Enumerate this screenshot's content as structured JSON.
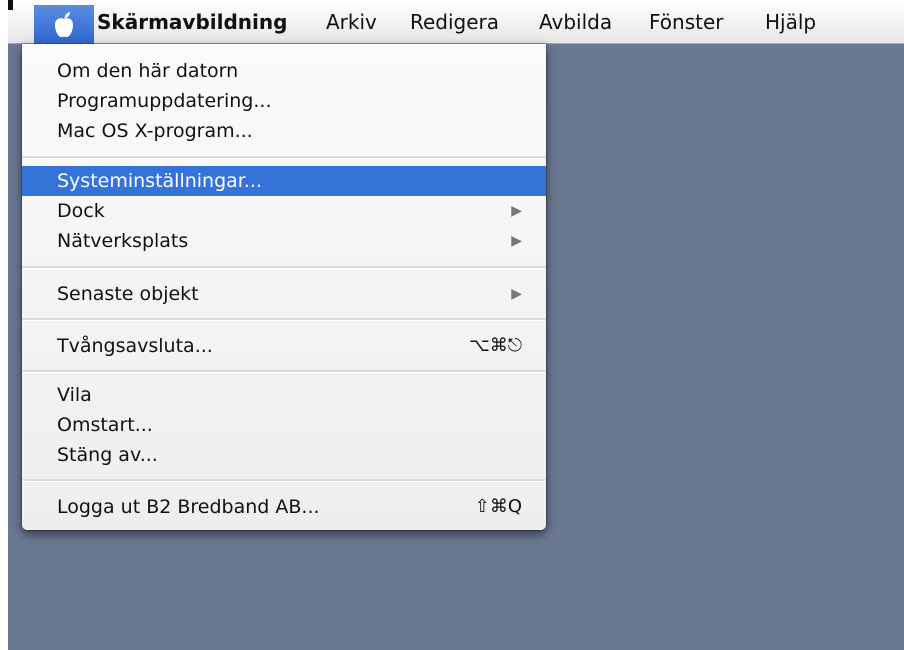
{
  "menubar": {
    "app_name": "Skärmavbildning",
    "menus": [
      "Arkiv",
      "Redigera",
      "Avbilda",
      "Fönster",
      "Hjälp"
    ]
  },
  "apple_menu": {
    "items": [
      {
        "label": "Om den här datorn"
      },
      {
        "label": "Programuppdatering..."
      },
      {
        "label": "Mac OS X-program..."
      },
      {
        "label": "Systeminställningar...",
        "selected": true
      },
      {
        "label": "Dock",
        "submenu": true
      },
      {
        "label": "Nätverksplats",
        "submenu": true
      },
      {
        "label": "Senaste objekt",
        "submenu": true
      },
      {
        "label": "Tvångsavsluta...",
        "shortcut": "⌥⌘⎋"
      },
      {
        "label": "Vila"
      },
      {
        "label": "Omstart..."
      },
      {
        "label": "Stäng av..."
      },
      {
        "label": "Logga ut B2 Bredband AB...",
        "shortcut": "⇧⌘Q"
      }
    ]
  },
  "colors": {
    "desktop": "#6b7892",
    "highlight": "#3673d9",
    "menubar": "#f4f4f4"
  },
  "icons": {
    "apple": "apple-logo-icon",
    "submenu": "submenu-arrow-icon"
  }
}
